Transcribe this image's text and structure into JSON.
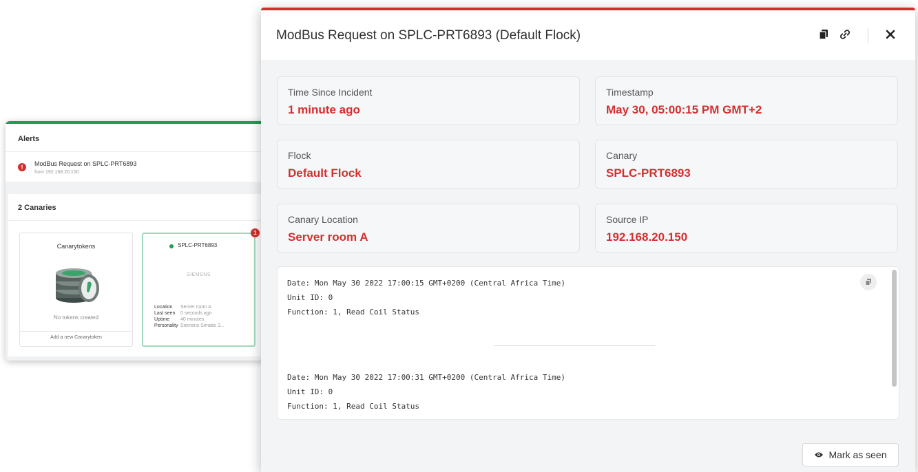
{
  "dashboard": {
    "alerts_title": "Alerts",
    "alert": {
      "icon": "!",
      "title": "ModBus Request on SPLC-PRT6893",
      "subtitle": "from 192.168.20.150"
    },
    "canaries_title": "2 Canaries",
    "tokens_card": {
      "title": "Canarytokens",
      "empty_text": "No tokens created",
      "add_label": "Add a new Canarytoken"
    },
    "device_card": {
      "name": "SPLC-PRT6893",
      "brand": "SIEMENS",
      "badge": "1",
      "details": [
        {
          "key": "Location",
          "value": "Server room A"
        },
        {
          "key": "Last seen",
          "value": "0 seconds ago"
        },
        {
          "key": "Uptime",
          "value": "40 minutes"
        },
        {
          "key": "Personality",
          "value": "Siemens Simatic 3..."
        }
      ]
    }
  },
  "modal": {
    "title": "ModBus Request on SPLC-PRT6893 (Default Flock)",
    "icons": [
      "copy-icon",
      "link-icon",
      "close-icon"
    ],
    "cards": [
      {
        "label": "Time Since Incident",
        "value": "1 minute ago"
      },
      {
        "label": "Timestamp",
        "value": "May 30, 05:00:15 PM GMT+2"
      },
      {
        "label": "Flock",
        "value": "Default Flock"
      },
      {
        "label": "Canary",
        "value": "SPLC-PRT6893"
      },
      {
        "label": "Canary Location",
        "value": "Server room A"
      },
      {
        "label": "Source IP",
        "value": "192.168.20.150"
      }
    ],
    "logs": [
      "Date: Mon May 30 2022 17:00:15 GMT+0200 (Central Africa Time)\nUnit ID: 0\nFunction: 1, Read Coil Status",
      "Date: Mon May 30 2022 17:00:31 GMT+0200 (Central Africa Time)\nUnit ID: 0\nFunction: 1, Read Coil Status"
    ],
    "mark_as_seen_label": "Mark as seen"
  },
  "colors": {
    "accent_red": "#d32f2f",
    "accent_green": "#1f9d55"
  }
}
